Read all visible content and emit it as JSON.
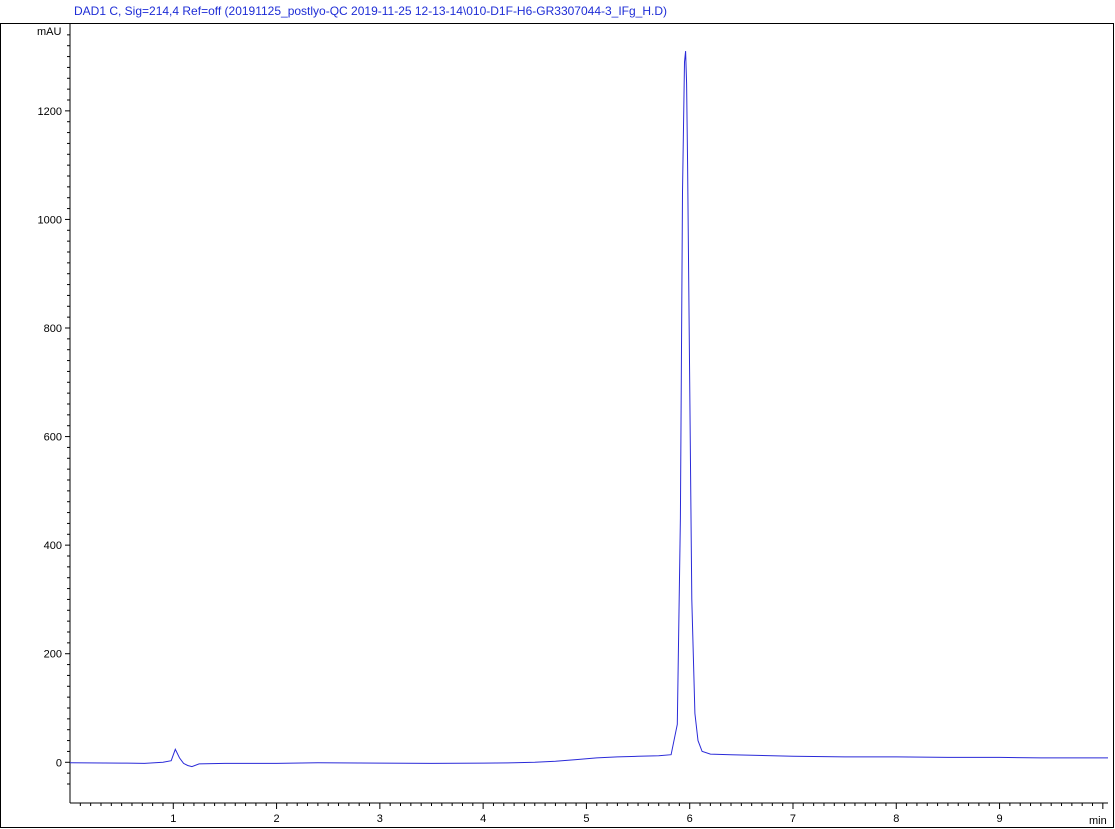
{
  "header": {
    "signal_label": "DAD1 C, Sig=214,4 Ref=off (20191125_postlyo-QC 2019-11-25 12-13-14\\010-D1F-H6-GR3307044-3_IFg_H.D)"
  },
  "colors": {
    "trace": "#2a2ad8",
    "axis": "#000000",
    "header_text": "#1e2dd6"
  },
  "chart_data": {
    "type": "line",
    "title": "DAD1 C, Sig=214,4 Ref=off (20191125_postlyo-QC 2019-11-25 12-13-14\\010-D1F-H6-GR3307044-3_IFg_H.D)",
    "ylabel": "mAU",
    "xlabel": "min",
    "xlim": [
      0,
      10.05
    ],
    "ylim": [
      -75,
      1360
    ],
    "x_ticks": [
      1,
      2,
      3,
      4,
      5,
      6,
      7,
      8,
      9
    ],
    "y_ticks": [
      0,
      200,
      400,
      600,
      800,
      1000,
      1200
    ],
    "grid": false,
    "legend": "none",
    "series": [
      {
        "x": [
          0,
          0.5,
          0.72,
          0.9,
          0.98,
          1.02,
          1.06,
          1.1,
          1.14,
          1.18,
          1.25,
          1.5,
          2.0,
          2.4,
          3.0,
          3.5,
          4.0,
          4.3,
          4.5,
          4.7,
          4.9,
          5.1,
          5.3,
          5.5,
          5.7,
          5.82,
          5.88,
          5.91,
          5.93,
          5.95,
          5.96,
          5.97,
          5.98,
          6.0,
          6.02,
          6.05,
          6.08,
          6.12,
          6.2,
          6.4,
          6.8,
          7.0,
          7.5,
          8.0,
          8.5,
          9.0,
          9.4,
          9.6,
          10.05
        ],
        "y": [
          -1,
          -1.5,
          -2,
          0,
          3,
          24,
          8,
          -2,
          -6,
          -8,
          -3,
          -2,
          -2,
          -1,
          -1.5,
          -2,
          -1.5,
          -1,
          0,
          2,
          5,
          8,
          10,
          11,
          12,
          14,
          70,
          450,
          1050,
          1290,
          1310,
          1250,
          1100,
          700,
          300,
          90,
          40,
          20,
          15,
          14,
          12,
          11,
          10,
          10,
          9,
          9,
          8,
          8,
          8
        ]
      }
    ]
  }
}
